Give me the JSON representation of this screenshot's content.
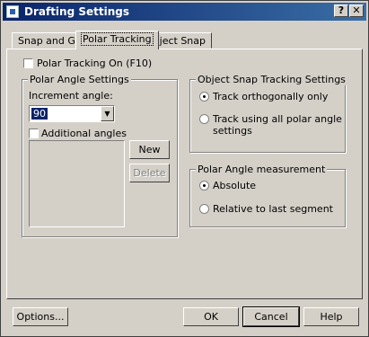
{
  "window": {
    "title": "Drafting Settings",
    "help_btn": "?",
    "close_btn": "✕"
  },
  "tabs": [
    {
      "label": "Snap and Grid"
    },
    {
      "label": "Polar Tracking"
    },
    {
      "label": "Object Snap"
    }
  ],
  "polar_on": {
    "label": "Polar Tracking On (F10)",
    "checked": false
  },
  "polar_angle": {
    "title": "Polar Angle Settings",
    "increment_label": "Increment angle:",
    "increment_value": "90",
    "additional_label": "Additional angles",
    "additional_checked": false,
    "new_button": "New",
    "delete_button": "Delete"
  },
  "object_snap": {
    "title": "Object Snap Tracking Settings",
    "opt1": "Track orthogonally only",
    "opt2_line1": "Track using all polar angle",
    "opt2_line2": "settings",
    "selected": "opt1"
  },
  "polar_measure": {
    "title": "Polar Angle measurement",
    "opt1": "Absolute",
    "opt2": "Relative to last segment",
    "selected": "opt1"
  },
  "footer": {
    "options": "Options...",
    "ok": "OK",
    "cancel": "Cancel",
    "help": "Help"
  }
}
